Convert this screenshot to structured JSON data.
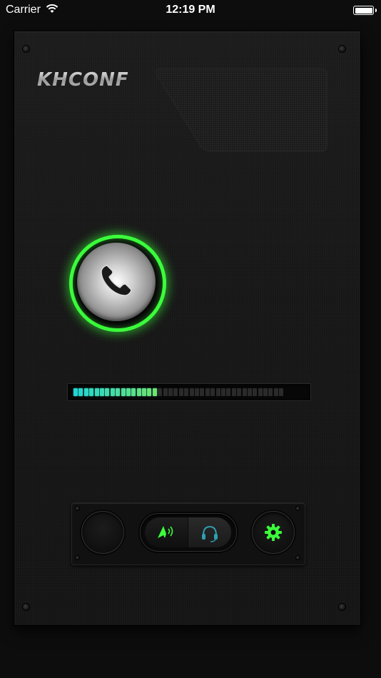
{
  "status_bar": {
    "carrier": "Carrier",
    "time": "12:19 PM"
  },
  "app": {
    "logo_text": "KHCONF"
  },
  "call_button": {
    "icon": "phone-icon",
    "ring_color": "#3bff3b"
  },
  "level_meter": {
    "total_segments": 40,
    "lit_segments": 16,
    "level_fraction": 0.4,
    "colors": {
      "low": "#1fd6d6",
      "high": "#6fe36f",
      "off": "#2a2a2a"
    }
  },
  "controls": {
    "left_button_icon": "",
    "audio_toggle": {
      "options": [
        "speaker",
        "headset"
      ],
      "selected": "speaker",
      "speaker_icon": "speaker-icon",
      "headset_icon": "headset-icon"
    },
    "settings_icon": "gear-icon",
    "accent_color": "#3bff3b"
  }
}
